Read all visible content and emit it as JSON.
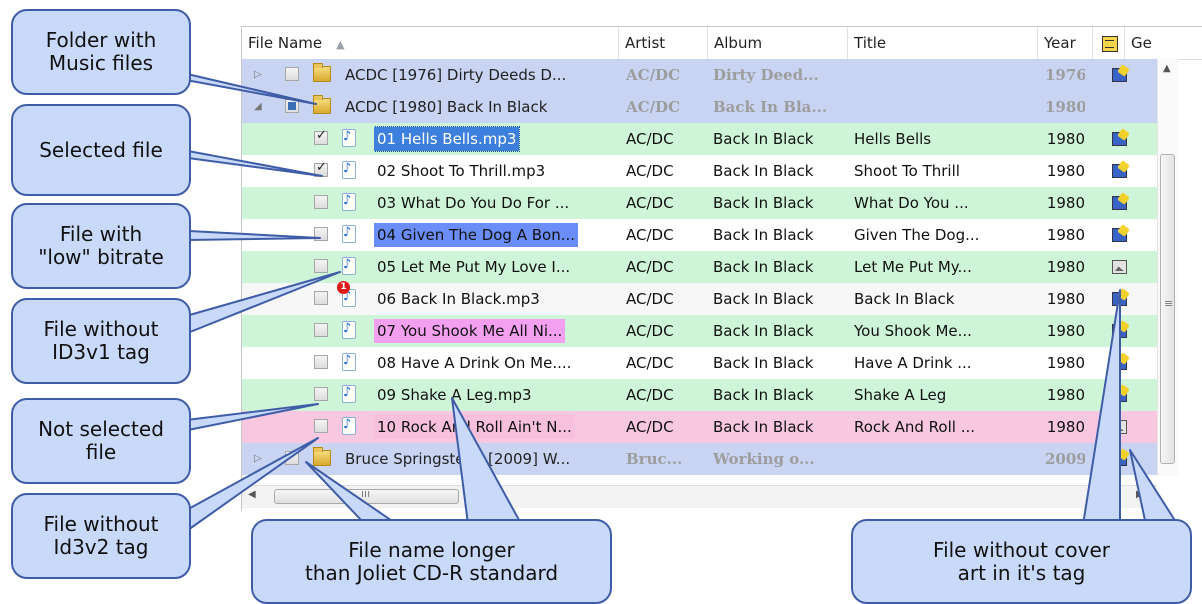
{
  "columns": {
    "file_name": "File Name",
    "artist": "Artist",
    "album": "Album",
    "title": "Title",
    "year": "Year",
    "genre": "Ge"
  },
  "rows": [
    {
      "kind": "folder",
      "name": "ACDC [1976] Dirty Deeds D...",
      "artist": "AC/DC",
      "album": "Dirty Deed...",
      "title": "",
      "year": "1976",
      "cover": "cover-art-icon",
      "row_color": "#c9d4f3",
      "expanded": false
    },
    {
      "kind": "folder",
      "name": "ACDC [1980] Back In Black",
      "artist": "AC/DC",
      "album": "Back In Bla...",
      "title": "",
      "year": "1980",
      "cover": "",
      "row_color": "#c9d4f3",
      "expanded": true
    },
    {
      "kind": "file",
      "name": "01 Hells Bells.mp3",
      "artist": "AC/DC",
      "album": "Back In Black",
      "title": "Hells Bells",
      "year": "1980",
      "cover": "cover-art-icon",
      "row_color": "#cff5d9",
      "checked": true,
      "name_style": "selected"
    },
    {
      "kind": "file",
      "name": "02 Shoot To Thrill.mp3",
      "artist": "AC/DC",
      "album": "Back In Black",
      "title": "Shoot To Thrill",
      "year": "1980",
      "cover": "cover-art-icon",
      "row_color": "#ffffff",
      "checked": true,
      "name_style": ""
    },
    {
      "kind": "file",
      "name": "03 What Do You Do For ...",
      "artist": "AC/DC",
      "album": "Back In Black",
      "title": "What Do You ...",
      "year": "1980",
      "cover": "cover-art-icon",
      "row_color": "#cff5d9",
      "checked": false,
      "name_style": ""
    },
    {
      "kind": "file",
      "name": "04 Given The Dog A Bon...",
      "artist": "AC/DC",
      "album": "Back In Black",
      "title": "Given The Dog...",
      "year": "1980",
      "cover": "cover-art-icon",
      "row_color": "#ffffff",
      "checked": false,
      "name_style": "hl-blue"
    },
    {
      "kind": "file",
      "name": "05 Let Me Put My Love I...",
      "artist": "AC/DC",
      "album": "Back In Black",
      "title": "Let Me Put My...",
      "year": "1980",
      "cover": "no-cover-art-icon",
      "row_color": "#cff5d9",
      "checked": false,
      "name_style": ""
    },
    {
      "kind": "file",
      "name": "06 Back In Black.mp3",
      "artist": "AC/DC",
      "album": "Back In Black",
      "title": "Back In Black",
      "year": "1980",
      "cover": "cover-art-icon",
      "row_color": "#f7f7f7",
      "checked": false,
      "name_style": "",
      "badge": "1"
    },
    {
      "kind": "file",
      "name": "07 You Shook Me All Ni...",
      "artist": "AC/DC",
      "album": "Back In Black",
      "title": "You Shook Me...",
      "year": "1980",
      "cover": "cover-art-icon",
      "row_color": "#cff5d9",
      "checked": false,
      "name_style": "hl-mag"
    },
    {
      "kind": "file",
      "name": "08 Have A Drink On Me....",
      "artist": "AC/DC",
      "album": "Back In Black",
      "title": "Have A Drink ...",
      "year": "1980",
      "cover": "cover-art-icon",
      "row_color": "#ffffff",
      "checked": false,
      "name_style": ""
    },
    {
      "kind": "file",
      "name": "09 Shake A Leg.mp3",
      "artist": "AC/DC",
      "album": "Back In Black",
      "title": "Shake A Leg",
      "year": "1980",
      "cover": "cover-art-icon",
      "row_color": "#cff5d9",
      "checked": false,
      "name_style": ""
    },
    {
      "kind": "file",
      "name": "10 Rock And Roll Ain't N...",
      "artist": "AC/DC",
      "album": "Back In Black",
      "title": "Rock And Roll ...",
      "year": "1980",
      "cover": "no-cover-art-icon",
      "row_color": "#f8c8e0",
      "checked": false,
      "name_style": "hl-pink"
    },
    {
      "kind": "folder",
      "name": "Bruce Springsteen [2009] W...",
      "artist": "Bruc...",
      "album": "Working o...",
      "title": "",
      "year": "2009",
      "cover": "cover-art-icon",
      "row_color": "#c9d4f3",
      "expanded": false
    }
  ],
  "callouts": [
    {
      "id": "folder",
      "text": "Folder with\nMusic files"
    },
    {
      "id": "selected",
      "text": "Selected file"
    },
    {
      "id": "low-bitrate",
      "text": "File with\n\"low\" bitrate"
    },
    {
      "id": "no-id3v1",
      "text": "File without\nID3v1 tag"
    },
    {
      "id": "not-selected",
      "text": "Not selected\nfile"
    },
    {
      "id": "no-id3v2",
      "text": "File without\nId3v2 tag"
    },
    {
      "id": "long-name",
      "text": "File name longer\nthan Joliet CD-R standard"
    },
    {
      "id": "no-cover",
      "text": "File without cover\nart in it's tag"
    }
  ],
  "colors": {
    "folder_row": "#c9d4f3",
    "alt_row_green": "#cff5d9",
    "low_bitrate": "#6a8df7",
    "long_name_magenta": "#f3a0f0",
    "no_id3v2_pink": "#f8c0dc",
    "callout_fill": "#c9d9f9",
    "callout_border": "#3f5da7"
  }
}
